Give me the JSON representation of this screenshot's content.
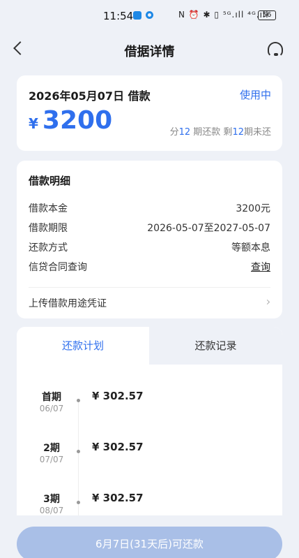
{
  "status_bar": {
    "time": "11:54",
    "icons_text": "N ⏰ ✱ ▯ ⁵ᴳ.ıll ⁴ᴳ.ıll",
    "battery": "56"
  },
  "nav": {
    "title": "借据详情"
  },
  "summary": {
    "date_label": "2026年05月07日 借款",
    "status": "使用中",
    "currency": "¥",
    "amount": "3200",
    "terms_prefix": "分",
    "total_periods": "12",
    "terms_mid": " 期还款 剩",
    "remaining_periods": "12",
    "terms_suffix": "期未还"
  },
  "detail": {
    "title": "借款明细",
    "rows": [
      {
        "label": "借款本金",
        "value": "3200元"
      },
      {
        "label": "借款期限",
        "value": "2026-05-07至2027-05-07"
      },
      {
        "label": "还款方式",
        "value": "等额本息"
      },
      {
        "label": "信贷合同查询",
        "value": "查询"
      }
    ],
    "upload_label": "上传借款用途凭证"
  },
  "tabs": [
    {
      "label": "还款计划",
      "active": true
    },
    {
      "label": "还款记录",
      "active": false
    }
  ],
  "plan": [
    {
      "period": "首期",
      "date": "06/07",
      "amount": "¥ 302.57"
    },
    {
      "period": "2期",
      "date": "07/07",
      "amount": "¥ 302.57"
    },
    {
      "period": "3期",
      "date": "08/07",
      "amount": "¥ 302.57"
    }
  ],
  "repay_button": "6月7日(31天后)可还款",
  "colors": {
    "accent": "#2f6fed",
    "background": "#eef1f7",
    "button_disabled": "#a9bfe7"
  }
}
